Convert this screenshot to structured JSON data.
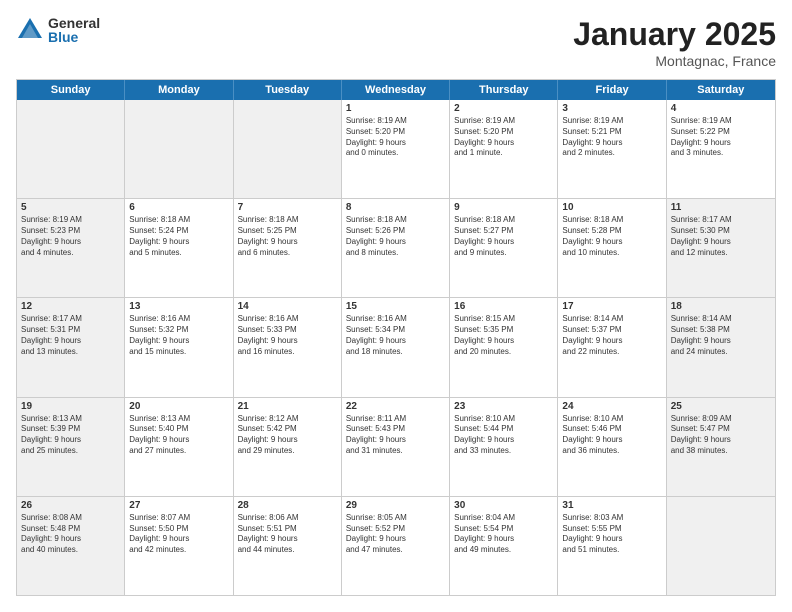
{
  "logo": {
    "general": "General",
    "blue": "Blue"
  },
  "title": "January 2025",
  "location": "Montagnac, France",
  "days": [
    "Sunday",
    "Monday",
    "Tuesday",
    "Wednesday",
    "Thursday",
    "Friday",
    "Saturday"
  ],
  "weeks": [
    [
      {
        "day": "",
        "text": "",
        "shaded": true
      },
      {
        "day": "",
        "text": "",
        "shaded": true
      },
      {
        "day": "",
        "text": "",
        "shaded": true
      },
      {
        "day": "1",
        "text": "Sunrise: 8:19 AM\nSunset: 5:20 PM\nDaylight: 9 hours\nand 0 minutes.",
        "shaded": false
      },
      {
        "day": "2",
        "text": "Sunrise: 8:19 AM\nSunset: 5:20 PM\nDaylight: 9 hours\nand 1 minute.",
        "shaded": false
      },
      {
        "day": "3",
        "text": "Sunrise: 8:19 AM\nSunset: 5:21 PM\nDaylight: 9 hours\nand 2 minutes.",
        "shaded": false
      },
      {
        "day": "4",
        "text": "Sunrise: 8:19 AM\nSunset: 5:22 PM\nDaylight: 9 hours\nand 3 minutes.",
        "shaded": false
      }
    ],
    [
      {
        "day": "5",
        "text": "Sunrise: 8:19 AM\nSunset: 5:23 PM\nDaylight: 9 hours\nand 4 minutes.",
        "shaded": true
      },
      {
        "day": "6",
        "text": "Sunrise: 8:18 AM\nSunset: 5:24 PM\nDaylight: 9 hours\nand 5 minutes.",
        "shaded": false
      },
      {
        "day": "7",
        "text": "Sunrise: 8:18 AM\nSunset: 5:25 PM\nDaylight: 9 hours\nand 6 minutes.",
        "shaded": false
      },
      {
        "day": "8",
        "text": "Sunrise: 8:18 AM\nSunset: 5:26 PM\nDaylight: 9 hours\nand 8 minutes.",
        "shaded": false
      },
      {
        "day": "9",
        "text": "Sunrise: 8:18 AM\nSunset: 5:27 PM\nDaylight: 9 hours\nand 9 minutes.",
        "shaded": false
      },
      {
        "day": "10",
        "text": "Sunrise: 8:18 AM\nSunset: 5:28 PM\nDaylight: 9 hours\nand 10 minutes.",
        "shaded": false
      },
      {
        "day": "11",
        "text": "Sunrise: 8:17 AM\nSunset: 5:30 PM\nDaylight: 9 hours\nand 12 minutes.",
        "shaded": true
      }
    ],
    [
      {
        "day": "12",
        "text": "Sunrise: 8:17 AM\nSunset: 5:31 PM\nDaylight: 9 hours\nand 13 minutes.",
        "shaded": true
      },
      {
        "day": "13",
        "text": "Sunrise: 8:16 AM\nSunset: 5:32 PM\nDaylight: 9 hours\nand 15 minutes.",
        "shaded": false
      },
      {
        "day": "14",
        "text": "Sunrise: 8:16 AM\nSunset: 5:33 PM\nDaylight: 9 hours\nand 16 minutes.",
        "shaded": false
      },
      {
        "day": "15",
        "text": "Sunrise: 8:16 AM\nSunset: 5:34 PM\nDaylight: 9 hours\nand 18 minutes.",
        "shaded": false
      },
      {
        "day": "16",
        "text": "Sunrise: 8:15 AM\nSunset: 5:35 PM\nDaylight: 9 hours\nand 20 minutes.",
        "shaded": false
      },
      {
        "day": "17",
        "text": "Sunrise: 8:14 AM\nSunset: 5:37 PM\nDaylight: 9 hours\nand 22 minutes.",
        "shaded": false
      },
      {
        "day": "18",
        "text": "Sunrise: 8:14 AM\nSunset: 5:38 PM\nDaylight: 9 hours\nand 24 minutes.",
        "shaded": true
      }
    ],
    [
      {
        "day": "19",
        "text": "Sunrise: 8:13 AM\nSunset: 5:39 PM\nDaylight: 9 hours\nand 25 minutes.",
        "shaded": true
      },
      {
        "day": "20",
        "text": "Sunrise: 8:13 AM\nSunset: 5:40 PM\nDaylight: 9 hours\nand 27 minutes.",
        "shaded": false
      },
      {
        "day": "21",
        "text": "Sunrise: 8:12 AM\nSunset: 5:42 PM\nDaylight: 9 hours\nand 29 minutes.",
        "shaded": false
      },
      {
        "day": "22",
        "text": "Sunrise: 8:11 AM\nSunset: 5:43 PM\nDaylight: 9 hours\nand 31 minutes.",
        "shaded": false
      },
      {
        "day": "23",
        "text": "Sunrise: 8:10 AM\nSunset: 5:44 PM\nDaylight: 9 hours\nand 33 minutes.",
        "shaded": false
      },
      {
        "day": "24",
        "text": "Sunrise: 8:10 AM\nSunset: 5:46 PM\nDaylight: 9 hours\nand 36 minutes.",
        "shaded": false
      },
      {
        "day": "25",
        "text": "Sunrise: 8:09 AM\nSunset: 5:47 PM\nDaylight: 9 hours\nand 38 minutes.",
        "shaded": true
      }
    ],
    [
      {
        "day": "26",
        "text": "Sunrise: 8:08 AM\nSunset: 5:48 PM\nDaylight: 9 hours\nand 40 minutes.",
        "shaded": true
      },
      {
        "day": "27",
        "text": "Sunrise: 8:07 AM\nSunset: 5:50 PM\nDaylight: 9 hours\nand 42 minutes.",
        "shaded": false
      },
      {
        "day": "28",
        "text": "Sunrise: 8:06 AM\nSunset: 5:51 PM\nDaylight: 9 hours\nand 44 minutes.",
        "shaded": false
      },
      {
        "day": "29",
        "text": "Sunrise: 8:05 AM\nSunset: 5:52 PM\nDaylight: 9 hours\nand 47 minutes.",
        "shaded": false
      },
      {
        "day": "30",
        "text": "Sunrise: 8:04 AM\nSunset: 5:54 PM\nDaylight: 9 hours\nand 49 minutes.",
        "shaded": false
      },
      {
        "day": "31",
        "text": "Sunrise: 8:03 AM\nSunset: 5:55 PM\nDaylight: 9 hours\nand 51 minutes.",
        "shaded": false
      },
      {
        "day": "",
        "text": "",
        "shaded": true
      }
    ]
  ]
}
